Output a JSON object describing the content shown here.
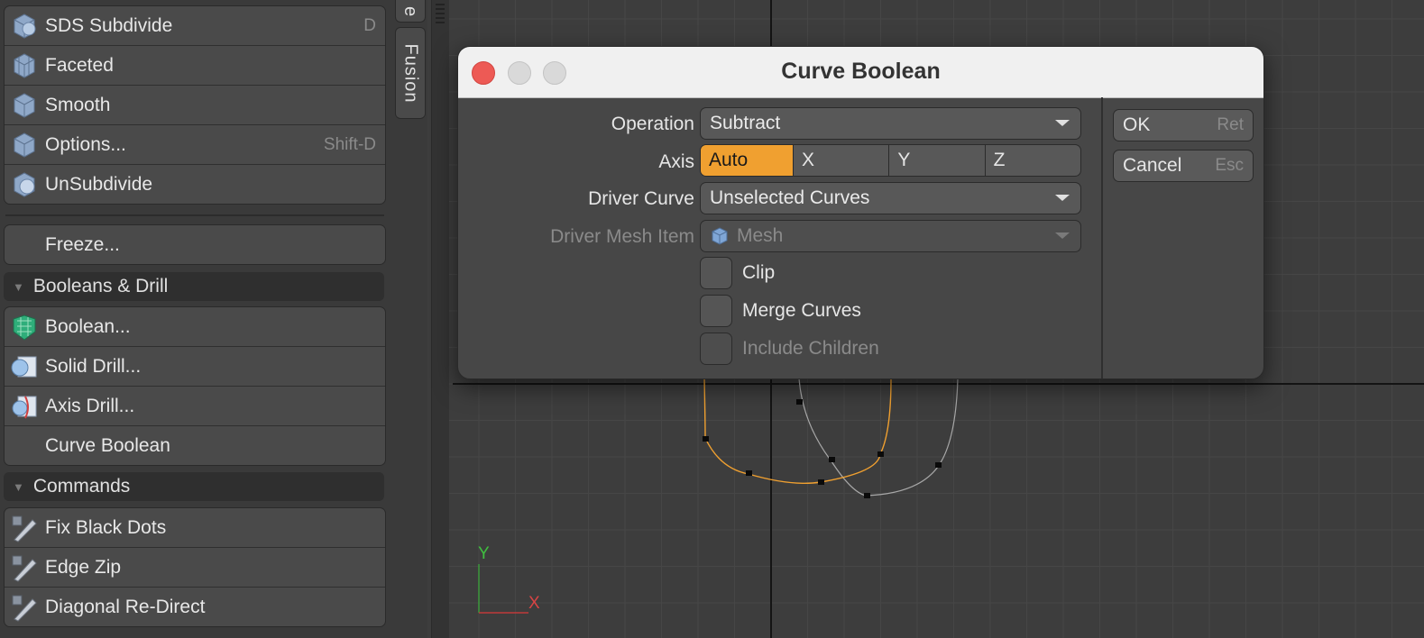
{
  "left_panel": {
    "subdivide_group": [
      {
        "label": "SDS Subdivide",
        "shortcut": "D",
        "icon": "sds-subdivide-icon"
      },
      {
        "label": "Faceted",
        "shortcut": "",
        "icon": "faceted-icon"
      },
      {
        "label": "Smooth",
        "shortcut": "",
        "icon": "smooth-icon"
      },
      {
        "label": "Options...",
        "shortcut": "Shift-D",
        "icon": "options-icon"
      },
      {
        "label": "UnSubdivide",
        "shortcut": "",
        "icon": "unsubdivide-icon"
      }
    ],
    "freeze_label": "Freeze...",
    "booleans_header": "Booleans & Drill",
    "booleans_group": [
      {
        "label": "Boolean...",
        "icon": "boolean-icon"
      },
      {
        "label": "Solid Drill...",
        "icon": "solid-drill-icon"
      },
      {
        "label": "Axis Drill...",
        "icon": "axis-drill-icon"
      },
      {
        "label": "Curve Boolean",
        "icon": ""
      }
    ],
    "commands_header": "Commands",
    "commands_group": [
      {
        "label": "Fix Black Dots",
        "icon": "knife-icon"
      },
      {
        "label": "Edge Zip",
        "icon": "knife-icon"
      },
      {
        "label": "Diagonal Re-Direct",
        "icon": "knife-icon"
      }
    ]
  },
  "tabs": {
    "partial_tab": "e",
    "fusion_tab": "Fusion"
  },
  "viewport": {
    "axis_x_label": "X",
    "axis_y_label": "Y",
    "colors": {
      "grid": "#464646",
      "axis": "#141414",
      "selected_curve": "#f0a030",
      "curve": "#a8a8a8"
    }
  },
  "dialog": {
    "title": "Curve Boolean",
    "operation_label": "Operation",
    "operation_value": "Subtract",
    "axis_label": "Axis",
    "axis_options": [
      "Auto",
      "X",
      "Y",
      "Z"
    ],
    "axis_selected": "Auto",
    "driver_curve_label": "Driver Curve",
    "driver_curve_value": "Unselected Curves",
    "driver_mesh_label": "Driver Mesh Item",
    "driver_mesh_value": "Mesh",
    "clip_label": "Clip",
    "merge_curves_label": "Merge Curves",
    "include_children_label": "Include Children",
    "ok_label": "OK",
    "ok_shortcut": "Ret",
    "cancel_label": "Cancel",
    "cancel_shortcut": "Esc",
    "accent_color": "#f0a030"
  }
}
